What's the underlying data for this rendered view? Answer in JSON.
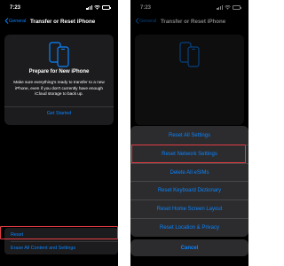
{
  "colors": {
    "accent": "#0a84ff",
    "highlight": "#e43d44",
    "background": "#000000",
    "card": "#1c1c1e",
    "sheet": "#2c2c2e"
  },
  "left": {
    "status_time": "7:23",
    "back_label": "General",
    "title": "Transfer or Reset iPhone",
    "card": {
      "icon": "two-phones-icon",
      "title": "Prepare for New iPhone",
      "description": "Make sure everything's ready to transfer to a new iPhone, even if you don't currently have enough iCloud storage to back up.",
      "link": "Get Started"
    },
    "bottom_items": [
      "Reset",
      "Erase All Content and Settings"
    ],
    "highlighted_item": "Reset"
  },
  "right": {
    "status_time": "7:23",
    "back_label": "General",
    "title": "Transfer or Reset iPhone",
    "reset_options": [
      "Reset All Settings",
      "Reset Network Settings",
      "Delete All eSIMs",
      "Reset Keyboard Dictionary",
      "Reset Home Screen Layout",
      "Reset Location & Privacy"
    ],
    "highlighted_option": "Reset Network Settings",
    "cancel_label": "Cancel"
  }
}
